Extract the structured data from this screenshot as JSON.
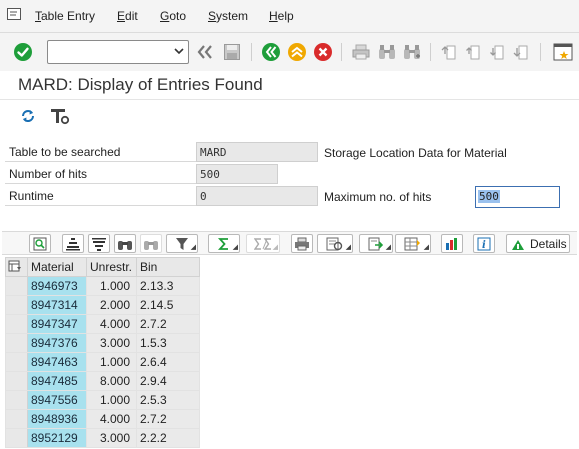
{
  "menubar": {
    "items": [
      "Table Entry",
      "Edit",
      "Goto",
      "System",
      "Help"
    ],
    "underlines": [
      "T",
      "E",
      "G",
      "S",
      "H"
    ]
  },
  "toolbar": {
    "command_value": "",
    "icons": [
      "ok-check-icon",
      "back-icon",
      "save-icon",
      "back-green-icon",
      "exit-yellow-icon",
      "cancel-red-icon",
      "print-icon",
      "find-icon",
      "find-next-icon",
      "first-page-icon",
      "prev-page-icon",
      "next-page-icon",
      "last-page-icon",
      "new-session-icon"
    ]
  },
  "page": {
    "title": "MARD: Display of Entries Found"
  },
  "form": {
    "table_label": "Table to be searched",
    "table_value": "MARD",
    "table_desc": "Storage Location Data for Material",
    "hits_label": "Number of hits",
    "hits_value": "500",
    "runtime_label": "Runtime",
    "runtime_value": "0",
    "maxhits_label": "Maximum no. of hits",
    "maxhits_value": "500"
  },
  "alv_toolbar": {
    "details_label": "Details"
  },
  "table": {
    "headers": [
      "Material",
      "Unrestr.",
      "Bin"
    ],
    "rows": [
      [
        "8946973",
        "1.000",
        "2.13.3"
      ],
      [
        "8947314",
        "2.000",
        "2.14.5"
      ],
      [
        "8947347",
        "4.000",
        "2.7.2"
      ],
      [
        "8947376",
        "3.000",
        "1.5.3"
      ],
      [
        "8947463",
        "1.000",
        "2.6.4"
      ],
      [
        "8947485",
        "8.000",
        "2.9.4"
      ],
      [
        "8947556",
        "1.000",
        "2.5.3"
      ],
      [
        "8948936",
        "4.000",
        "2.7.2"
      ],
      [
        "8952129",
        "3.000",
        "2.2.2"
      ]
    ]
  },
  "colors": {
    "key_column": "#a8e1ee",
    "ok_green": "#1e9e3a",
    "exit_yellow": "#f0a800",
    "cancel_red": "#d92b2b",
    "focus_blue": "#3c6fb1"
  }
}
